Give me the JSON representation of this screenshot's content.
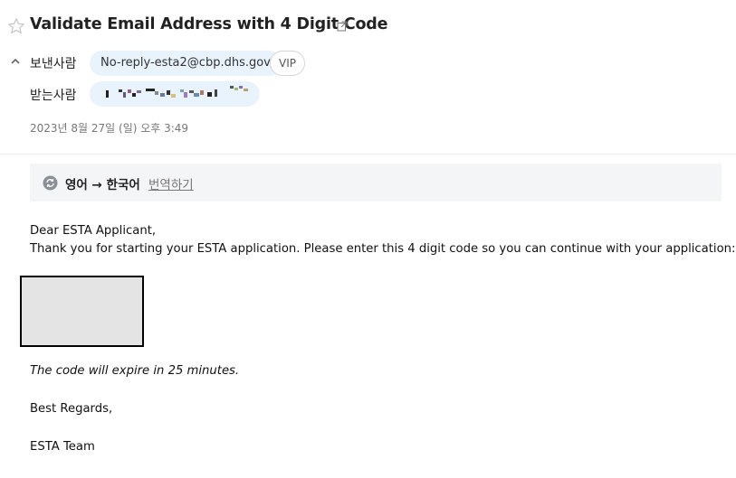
{
  "email": {
    "subject": "Validate Email Address with 4 Digit Code",
    "from_label": "보낸사람",
    "from_address": "No-reply-esta2@cbp.dhs.gov",
    "vip_badge": "VIP",
    "to_label": "받는사람",
    "date": "2023년 8월 27일 (일) 오후 3:49"
  },
  "translate_bar": {
    "languages": "영어 → 한국어",
    "link": "번역하기"
  },
  "message": {
    "greeting": "Dear ESTA Applicant,",
    "intro": "Thank you for starting your ESTA application. Please enter this 4 digit code so you can continue with your application:",
    "expiry": "The code will expire in 25 minutes.",
    "closing": "Best Regards,",
    "signature": "ESTA Team"
  },
  "icons": {
    "star": "star-outline-icon",
    "external": "open-external-icon",
    "collapse": "chevron-up-icon",
    "translate": "translate-icon"
  },
  "colors": {
    "chip_bg": "#e9f3fd",
    "translate_bar_bg": "#f4f5f7",
    "code_box_bg": "#e4e4e4"
  }
}
